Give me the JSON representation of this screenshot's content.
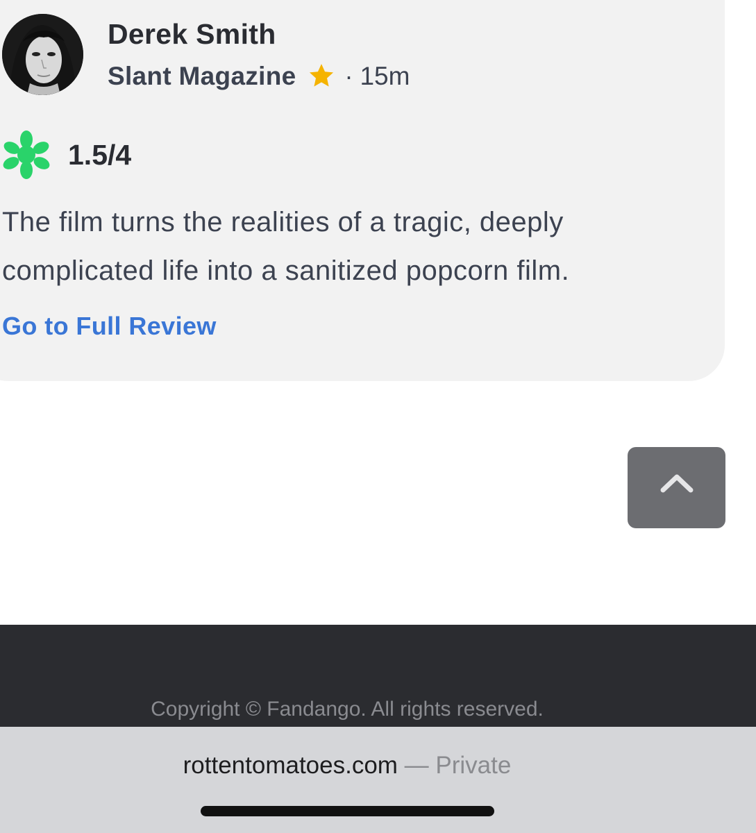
{
  "review": {
    "critic_name": "Derek Smith",
    "publication": "Slant Magazine",
    "dot_separator": "·",
    "timestamp": "15m",
    "score": "1.5/4",
    "quote": "The film turns the realities of a tragic, deeply complicated life into a sanitized popcorn film.",
    "link_label": "Go to Full Review",
    "rating_icon": "rotten-splat-icon",
    "top_critic_icon": "star-icon",
    "colors": {
      "card_bg": "#f2f2f2",
      "splat_green": "#2ad36a",
      "star_gold": "#f5b301",
      "link_blue": "#3a76d6"
    }
  },
  "back_to_top": {
    "icon": "chevron-up-icon"
  },
  "footer": {
    "copyright": "Copyright © Fandango. All rights reserved."
  },
  "browser": {
    "domain": "rottentomatoes.com",
    "mode": " — Private"
  }
}
